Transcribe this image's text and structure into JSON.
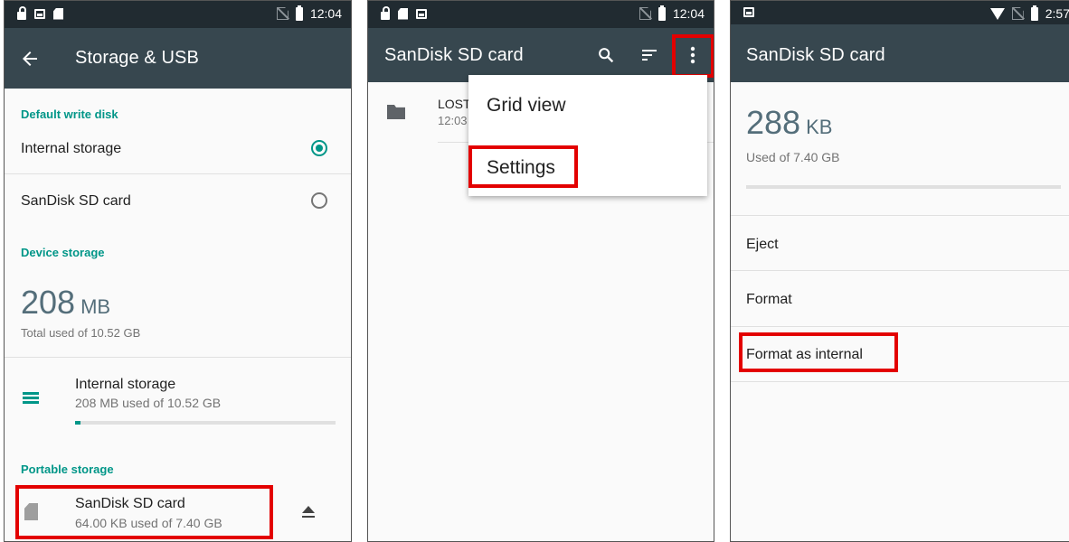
{
  "panel1": {
    "status": {
      "time": "12:04"
    },
    "title": "Storage & USB",
    "default_write_disk": {
      "header": "Default write disk",
      "options": [
        {
          "label": "Internal storage",
          "selected": true
        },
        {
          "label": "SanDisk SD card",
          "selected": false
        }
      ]
    },
    "device_storage": {
      "header": "Device storage",
      "amount": "208",
      "unit": "MB",
      "total": "Total used of 10.52 GB",
      "internal": {
        "label": "Internal storage",
        "detail": "208 MB used of 10.52 GB",
        "fraction_used": 0.02
      }
    },
    "portable_storage": {
      "header": "Portable storage",
      "card": {
        "label": "SanDisk SD card",
        "detail": "64.00 KB used of 7.40 GB"
      }
    }
  },
  "panel2": {
    "status": {
      "time": "12:04"
    },
    "title": "SanDisk SD card",
    "file": {
      "name": "LOST",
      "time": "12:03"
    },
    "menu": [
      "Grid view",
      "Settings"
    ]
  },
  "panel3": {
    "status": {
      "time": "2:57"
    },
    "title": "SanDisk SD card",
    "amount": "288",
    "unit": "KB",
    "used_of": "Used of 7.40 GB",
    "actions": [
      "Eject",
      "Format",
      "Format as internal"
    ]
  },
  "colors": {
    "appbar": "#37474f",
    "statusbar": "#212b31",
    "accent": "#009688",
    "highlight": "#e30000"
  }
}
